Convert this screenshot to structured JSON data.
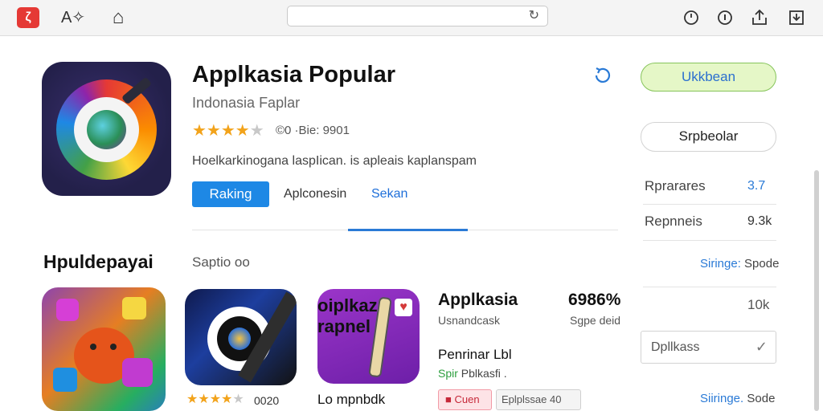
{
  "toolbar": {
    "app_icon_glyph": "ζ",
    "translate_glyph": "A✧",
    "home_glyph": "⌂",
    "url": "",
    "reload_glyph": "↻",
    "icons": [
      "clock-icon",
      "info-icon",
      "share-icon",
      "download-icon"
    ]
  },
  "hero": {
    "title": "Applkasia Popular",
    "subtitle": "Indonasia Faplar",
    "rating_text": "©0 ·Bie: 9901",
    "stars": 4,
    "description": "Hoelkarkinogana laspIican. is apleais kaplanspam",
    "ranking_button": "Raking",
    "tab_apl": "Aplconesin",
    "tab_sek": "Sekan"
  },
  "right": {
    "primary_button": "Ukkbean",
    "secondary_button": "Srpbeolar",
    "stats": [
      {
        "label": "Rprarares",
        "value": "3.7"
      },
      {
        "label": "Repnneis",
        "value": "9.3k"
      }
    ],
    "link1_a": "Siringe:",
    "link1_b": "Spode",
    "count": "10k",
    "select_value": "Dpllkass",
    "link2_a": "Siiringe.",
    "link2_b": "Sode"
  },
  "section": {
    "title": "Hpuldepayai",
    "subtitle": "Saptio oo"
  },
  "cards": {
    "card2_rating_text": "0020",
    "card3_label": "Lo mpnbdk",
    "card3_art_text": "oiplkaz\nrapnel"
  },
  "featured": {
    "title": "Applkasia",
    "percent": "6986%",
    "sub": "Usnandcask",
    "sub2": "Sgpe deid",
    "name": "Penrinar Lbl",
    "tag_green": "Spir",
    "tag_rest": "Pblkasfi .",
    "chip_red": "Cuen",
    "chip_gray": "Eplplssae   40"
  },
  "colors": {
    "accent": "#1e88e5",
    "primary_green_bg": "#e5f7c7",
    "primary_green_border": "#86c45b",
    "star": "#f2a31b",
    "chip_red": "#c62839"
  }
}
